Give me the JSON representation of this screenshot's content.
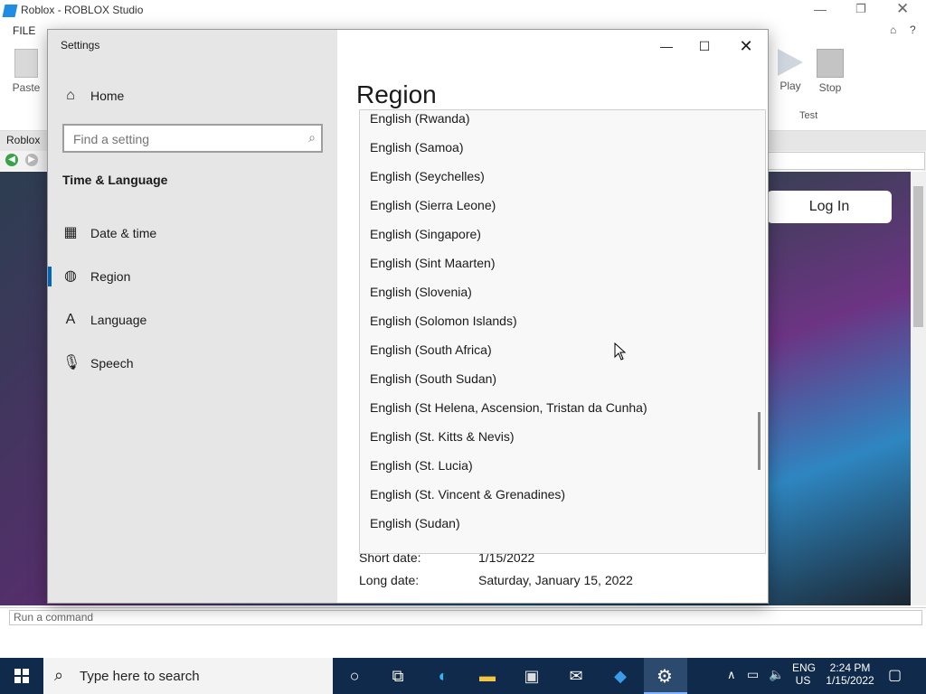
{
  "studio": {
    "title": "Roblox - ROBLOX Studio",
    "menu_file": "FILE",
    "paste_label": "Paste",
    "play_label": "Play",
    "stop_label": "Stop",
    "test_group_label": "Test",
    "doc_tab": "Roblox",
    "login_label": "Log In",
    "command_placeholder": "Run a command"
  },
  "settings": {
    "window_title": "Settings",
    "home_label": "Home",
    "search_placeholder": "Find a setting",
    "section_title": "Time & Language",
    "nav": [
      {
        "label": "Date & time",
        "icon": "calendar-clock-icon"
      },
      {
        "label": "Region",
        "icon": "globe-icon"
      },
      {
        "label": "Language",
        "icon": "language-icon"
      },
      {
        "label": "Speech",
        "icon": "microphone-icon"
      }
    ],
    "selected_nav": "Region",
    "page_title": "Region",
    "region_list": [
      "English (Rwanda)",
      "English (Samoa)",
      "English (Seychelles)",
      "English (Sierra Leone)",
      "English (Singapore)",
      "English (Sint Maarten)",
      "English (Slovenia)",
      "English (Solomon Islands)",
      "English (South Africa)",
      "English (South Sudan)",
      "English (St Helena, Ascension, Tristan da Cunha)",
      "English (St. Kitts & Nevis)",
      "English (St. Lucia)",
      "English (St. Vincent & Grenadines)",
      "English (Sudan)"
    ],
    "short_date_label": "Short date:",
    "short_date_value": "1/15/2022",
    "long_date_label": "Long date:",
    "long_date_value": "Saturday, January 15, 2022"
  },
  "taskbar": {
    "search_text": "Type here to search",
    "lang_top": "ENG",
    "lang_bottom": "US",
    "time": "2:24 PM",
    "date": "1/15/2022"
  }
}
